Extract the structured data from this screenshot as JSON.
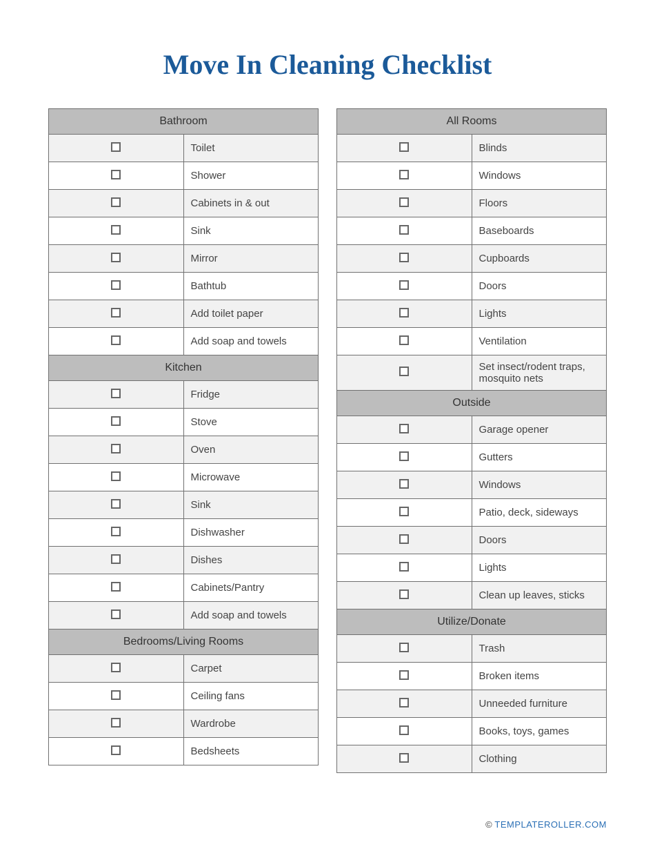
{
  "title": "Move In Cleaning Checklist",
  "footer": {
    "copyright": "©",
    "link": "TEMPLATEROLLER.COM"
  },
  "left": [
    {
      "header": "Bathroom",
      "items": [
        "Toilet",
        "Shower",
        "Cabinets in & out",
        "Sink",
        "Mirror",
        "Bathtub",
        "Add toilet paper",
        "Add soap and towels"
      ]
    },
    {
      "header": "Kitchen",
      "items": [
        "Fridge",
        "Stove",
        "Oven",
        "Microwave",
        "Sink",
        "Dishwasher",
        "Dishes",
        "Cabinets/Pantry",
        "Add soap and towels"
      ]
    },
    {
      "header": "Bedrooms/Living Rooms",
      "items": [
        "Carpet",
        "Ceiling fans",
        "Wardrobe",
        "Bedsheets"
      ]
    }
  ],
  "right": [
    {
      "header": "All Rooms",
      "items": [
        "Blinds",
        "Windows",
        "Floors",
        "Baseboards",
        "Cupboards",
        "Doors",
        "Lights",
        "Ventilation",
        "Set insect/rodent traps, mosquito nets"
      ]
    },
    {
      "header": "Outside",
      "items": [
        "Garage opener",
        "Gutters",
        "Windows",
        "Patio, deck, sideways",
        "Doors",
        "Lights",
        "Clean up leaves, sticks"
      ]
    },
    {
      "header": "Utilize/Donate",
      "items": [
        "Trash",
        "Broken items",
        "Unneeded furniture",
        "Books, toys, games",
        "Clothing"
      ]
    }
  ]
}
